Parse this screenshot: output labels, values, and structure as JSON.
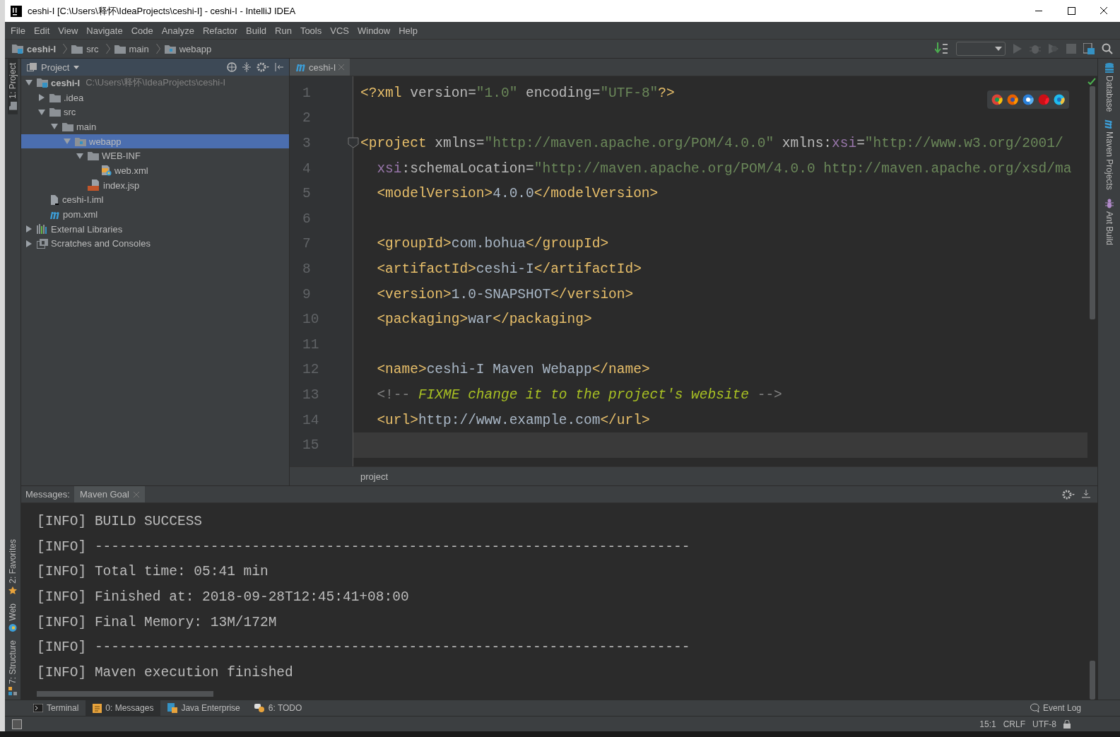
{
  "window": {
    "title": "ceshi-I [C:\\Users\\释怀\\IdeaProjects\\ceshi-I] - ceshi-I - IntelliJ IDEA"
  },
  "menu": [
    {
      "label": "File"
    },
    {
      "label": "Edit"
    },
    {
      "label": "View"
    },
    {
      "label": "Navigate"
    },
    {
      "label": "Code"
    },
    {
      "label": "Analyze"
    },
    {
      "label": "Refactor"
    },
    {
      "label": "Build"
    },
    {
      "label": "Run"
    },
    {
      "label": "Tools"
    },
    {
      "label": "VCS"
    },
    {
      "label": "Window"
    },
    {
      "label": "Help"
    }
  ],
  "breadcrumbs": [
    {
      "label": "ceshi-I",
      "kind": "module"
    },
    {
      "label": "src",
      "kind": "folder"
    },
    {
      "label": "main",
      "kind": "folder"
    },
    {
      "label": "webapp",
      "kind": "webfolder"
    }
  ],
  "left_stripe": {
    "top": [
      {
        "label": "1: Project",
        "selected": true
      }
    ],
    "bottom": [
      {
        "label": "2: Favorites",
        "kind": "favorites"
      },
      {
        "label": "Web",
        "kind": "web"
      },
      {
        "label": "7: Structure",
        "kind": "structure"
      }
    ]
  },
  "right_stripe": [
    {
      "label": "Database",
      "kind": "database"
    },
    {
      "label": "Maven Projects",
      "kind": "maven"
    },
    {
      "label": "Ant Build",
      "kind": "ant"
    }
  ],
  "project_panel": {
    "title": "Project",
    "tree": [
      {
        "label": "ceshi-I",
        "path": "C:\\Users\\释怀\\IdeaProjects\\ceshi-I",
        "kind": "module",
        "expanded": true,
        "selected": false,
        "children": [
          {
            "label": ".idea",
            "kind": "folder",
            "expanded": false,
            "selected": false
          },
          {
            "label": "src",
            "kind": "folder",
            "expanded": true,
            "selected": false,
            "children": [
              {
                "label": "main",
                "kind": "folder",
                "expanded": true,
                "selected": false,
                "children": [
                  {
                    "label": "webapp",
                    "kind": "webfolder",
                    "expanded": true,
                    "selected": true,
                    "children": [
                      {
                        "label": "WEB-INF",
                        "kind": "folder",
                        "expanded": true,
                        "selected": false,
                        "children": [
                          {
                            "label": "web.xml",
                            "kind": "xml",
                            "selected": false
                          }
                        ]
                      },
                      {
                        "label": "index.jsp",
                        "kind": "jsp",
                        "selected": false
                      }
                    ]
                  }
                ]
              }
            ]
          },
          {
            "label": "ceshi-I.iml",
            "kind": "iml",
            "selected": false
          },
          {
            "label": "pom.xml",
            "kind": "maven",
            "selected": false
          }
        ]
      },
      {
        "label": "External Libraries",
        "kind": "libraries",
        "expanded": false,
        "selected": false
      },
      {
        "label": "Scratches and Consoles",
        "kind": "scratches",
        "expanded": false,
        "selected": false
      }
    ]
  },
  "editor": {
    "tabs": [
      {
        "label": "ceshi-I",
        "selected": true
      }
    ],
    "lines": [
      {
        "number": "1",
        "highlighted": false,
        "fold": false,
        "tokens": [
          {
            "kind": "tag",
            "text": "<?xml "
          },
          {
            "kind": "attr",
            "text": "version="
          },
          {
            "kind": "value",
            "text": "\"1.0\""
          },
          {
            "kind": "attr",
            "text": " encoding="
          },
          {
            "kind": "value",
            "text": "\"UTF-8\""
          },
          {
            "kind": "tag",
            "text": "?>"
          }
        ]
      },
      {
        "number": "2",
        "highlighted": false,
        "fold": false
      },
      {
        "number": "3",
        "highlighted": false,
        "fold": true,
        "tokens": [
          {
            "kind": "tag",
            "text": "<project"
          },
          {
            "kind": "attr",
            "text": " xmlns="
          },
          {
            "kind": "value",
            "text": "\"http://maven.apache.org/POM/4.0.0\""
          },
          {
            "kind": "attr",
            "text": " xmlns:"
          },
          {
            "kind": "ns",
            "text": "xsi"
          },
          {
            "kind": "attr",
            "text": "="
          },
          {
            "kind": "value",
            "text": "\"http://www.w3.org/2001/"
          }
        ]
      },
      {
        "number": "4",
        "highlighted": false,
        "fold": false,
        "tokens": [
          {
            "kind": "ns",
            "text": "  xsi"
          },
          {
            "kind": "attr",
            "text": ":schemaLocation="
          },
          {
            "kind": "value",
            "text": "\"http://maven.apache.org/POM/4.0.0 http://maven.apache.org/xsd/ma"
          }
        ]
      },
      {
        "number": "5",
        "highlighted": false,
        "fold": false,
        "tokens": [
          {
            "kind": "tag",
            "text": "  <modelVersion>"
          },
          {
            "kind": "text",
            "text": "4.0.0"
          },
          {
            "kind": "tag",
            "text": "</modelVersion>"
          }
        ]
      },
      {
        "number": "6",
        "highlighted": false,
        "fold": false
      },
      {
        "number": "7",
        "highlighted": false,
        "fold": false,
        "tokens": [
          {
            "kind": "tag",
            "text": "  <groupId>"
          },
          {
            "kind": "text",
            "text": "com.bohua"
          },
          {
            "kind": "tag",
            "text": "</groupId>"
          }
        ]
      },
      {
        "number": "8",
        "highlighted": false,
        "fold": false,
        "tokens": [
          {
            "kind": "tag",
            "text": "  <artifactId>"
          },
          {
            "kind": "text",
            "text": "ceshi-I"
          },
          {
            "kind": "tag",
            "text": "</artifactId>"
          }
        ]
      },
      {
        "number": "9",
        "highlighted": false,
        "fold": false,
        "tokens": [
          {
            "kind": "tag",
            "text": "  <version>"
          },
          {
            "kind": "text",
            "text": "1.0-SNAPSHOT"
          },
          {
            "kind": "tag",
            "text": "</version>"
          }
        ]
      },
      {
        "number": "10",
        "highlighted": false,
        "fold": false,
        "tokens": [
          {
            "kind": "tag",
            "text": "  <packaging>"
          },
          {
            "kind": "text",
            "text": "war"
          },
          {
            "kind": "tag",
            "text": "</packaging>"
          }
        ]
      },
      {
        "number": "11",
        "highlighted": false,
        "fold": false
      },
      {
        "number": "12",
        "highlighted": false,
        "fold": false,
        "tokens": [
          {
            "kind": "tag",
            "text": "  <name>"
          },
          {
            "kind": "text",
            "text": "ceshi-I Maven Webapp"
          },
          {
            "kind": "tag",
            "text": "</name>"
          }
        ]
      },
      {
        "number": "13",
        "highlighted": false,
        "fold": false,
        "tokens": [
          {
            "kind": "comment",
            "text": "  <!-- "
          },
          {
            "kind": "todo",
            "text": "FIXME change it to the project's website"
          },
          {
            "kind": "comment",
            "text": " -->"
          }
        ]
      },
      {
        "number": "14",
        "highlighted": false,
        "fold": false,
        "tokens": [
          {
            "kind": "tag",
            "text": "  <url>"
          },
          {
            "kind": "text",
            "text": "http://www.example.com"
          },
          {
            "kind": "tag",
            "text": "</url>"
          }
        ]
      },
      {
        "number": "15",
        "highlighted": true,
        "fold": false
      }
    ],
    "breadcrumb": "project"
  },
  "messages": {
    "title": "Messages:",
    "tabs": [
      {
        "label": "Maven Goal",
        "selected": true
      }
    ],
    "lines": [
      "[INFO] BUILD SUCCESS",
      "[INFO] ------------------------------------------------------------------------",
      "[INFO] Total time: 05:41 min",
      "[INFO] Finished at: 2018-09-28T12:45:41+08:00",
      "[INFO] Final Memory: 13M/172M",
      "[INFO] ------------------------------------------------------------------------",
      "[INFO] Maven execution finished"
    ]
  },
  "bottom_tabs": [
    {
      "label": "Terminal",
      "kind": "terminal",
      "selected": false
    },
    {
      "label": "0: Messages",
      "kind": "messages",
      "selected": true
    },
    {
      "label": "Java Enterprise",
      "kind": "javaee",
      "selected": false
    },
    {
      "label": "6: TODO",
      "kind": "todo",
      "selected": false
    }
  ],
  "event_log": "Event Log",
  "status_bar": {
    "position": "15:1",
    "line_separator": "CRLF",
    "encoding": "UTF-8"
  }
}
